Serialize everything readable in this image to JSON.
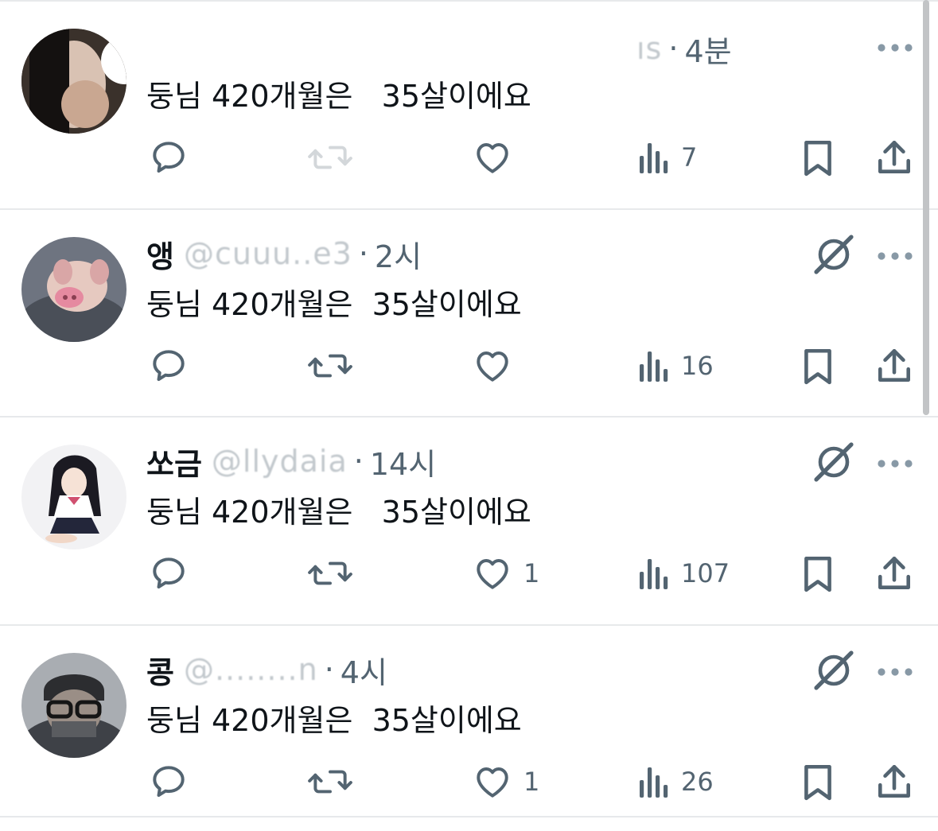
{
  "posts": [
    {
      "name": "",
      "handle": "ıs",
      "time": "4분",
      "text": "둥님 420개월은   35살이에요",
      "show_grok": false,
      "retweet_faded": true,
      "replies": "",
      "reposts": "",
      "likes": "",
      "views": "7"
    },
    {
      "name": "앵",
      "handle": "@cuuu..e3",
      "time": "2시",
      "text": "둥님 420개월은  35살이에요",
      "show_grok": true,
      "retweet_faded": false,
      "replies": "",
      "reposts": "",
      "likes": "",
      "views": "16"
    },
    {
      "name": "쏘금",
      "handle": "@llydaia",
      "time": "14시",
      "text": "둥님 420개월은   35살이에요",
      "show_grok": true,
      "retweet_faded": false,
      "replies": "",
      "reposts": "",
      "likes": "1",
      "views": "107"
    },
    {
      "name": "콩",
      "handle": "@........n",
      "time": "4시",
      "text": "둥님 420개월은  35살이에요",
      "show_grok": true,
      "retweet_faded": false,
      "replies": "",
      "reposts": "",
      "likes": "1",
      "views": "26"
    }
  ],
  "icons": {
    "reply": "reply-icon",
    "repost": "repost-icon",
    "like": "heart-icon",
    "views": "views-icon",
    "bookmark": "bookmark-icon",
    "share": "share-icon",
    "grok": "grok-icon",
    "more": "more-icon"
  },
  "colors": {
    "text": "#0f1419",
    "secondary": "#536471",
    "divider": "#e7e9eb",
    "background": "#ffffff"
  }
}
